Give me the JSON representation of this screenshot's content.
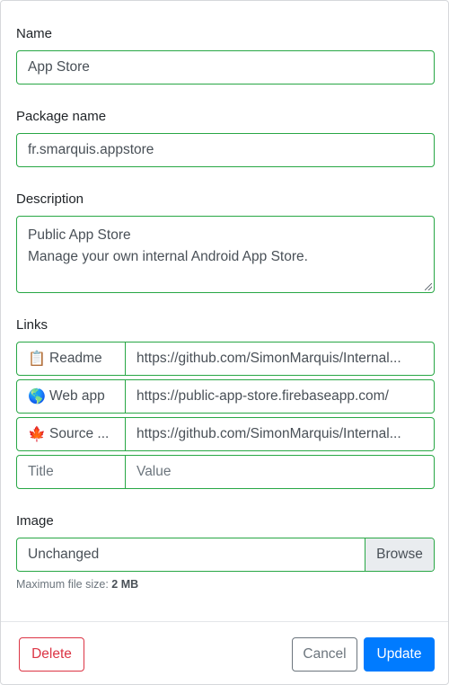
{
  "form": {
    "name": {
      "label": "Name",
      "value": "App Store"
    },
    "package": {
      "label": "Package name",
      "value": "fr.smarquis.appstore"
    },
    "description": {
      "label": "Description",
      "line1": "Public App Store",
      "line2": "Manage your own internal Android App Store."
    },
    "links": {
      "label": "Links",
      "rows": [
        {
          "icon": "📋",
          "icon_name": "clipboard-icon",
          "title": "Readme",
          "value": "https://github.com/SimonMarquis/Internal..."
        },
        {
          "icon": "🌎",
          "icon_name": "globe-icon",
          "title": "Web app",
          "value": "https://public-app-store.firebaseapp.com/"
        },
        {
          "icon": "🍁",
          "icon_name": "maple-leaf-icon",
          "title": "Source ...",
          "value": "https://github.com/SimonMarquis/Internal..."
        }
      ],
      "new_title_placeholder": "Title",
      "new_value_placeholder": "Value"
    },
    "image": {
      "label": "Image",
      "file_value": "Unchanged",
      "browse_label": "Browse",
      "help_prefix": "Maximum file size:",
      "help_size": "2 MB"
    }
  },
  "footer": {
    "delete_label": "Delete",
    "cancel_label": "Cancel",
    "update_label": "Update"
  },
  "colors": {
    "valid_border": "#28a745",
    "danger": "#dc3545",
    "secondary": "#6c757d",
    "primary": "#007bff"
  }
}
